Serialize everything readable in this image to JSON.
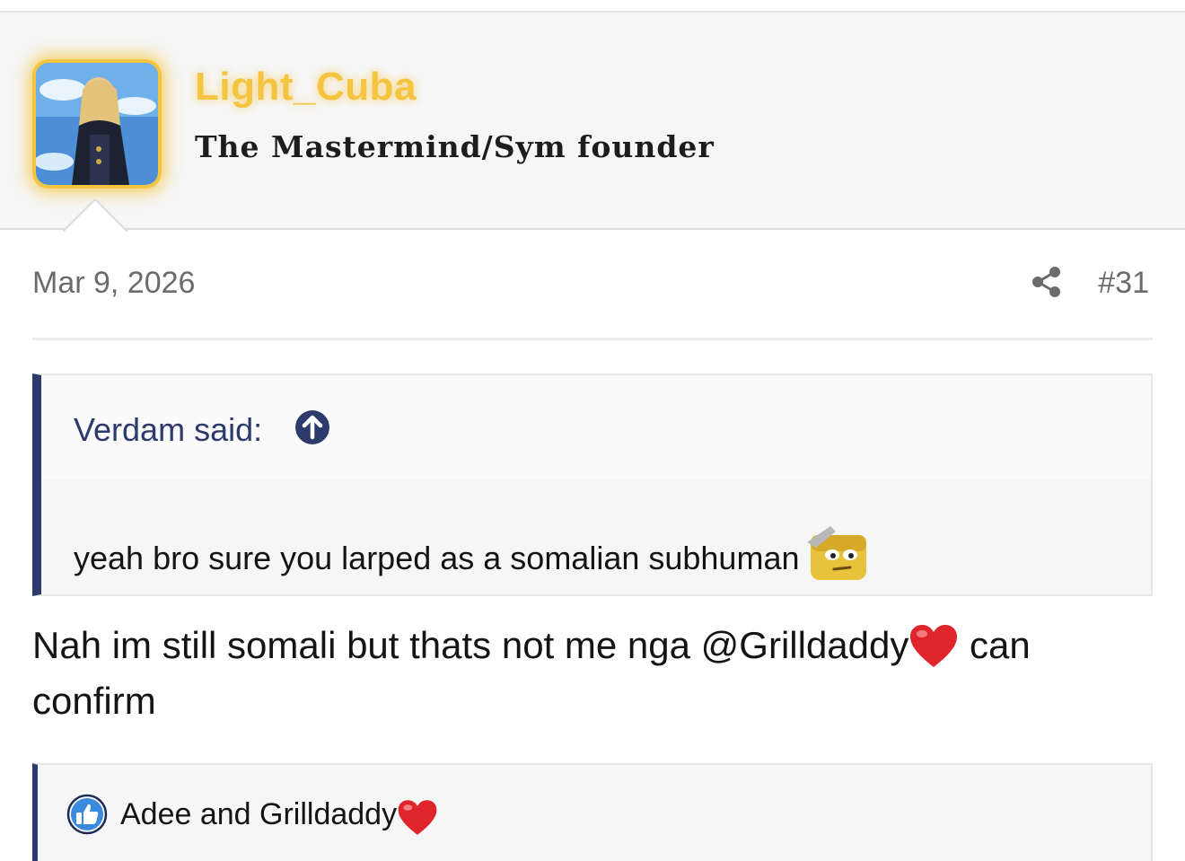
{
  "user": {
    "name": "Light_Cuba",
    "title": "The Mastermind/Sym founder",
    "accent_color": "#f5c542"
  },
  "post": {
    "date": "Mar 9, 2026",
    "number": "#31",
    "share_icon": "share-icon"
  },
  "quote": {
    "author": "Verdam said:",
    "text": "yeah bro sure you larped as a somalian subhuman",
    "emoji": "salute-face-emoji",
    "accent_color": "#2d3a6c"
  },
  "message": {
    "line1_prefix": "Nah im still somali but thats not me nga @Grilldaddy",
    "line1_suffix": " can",
    "line2": "confirm"
  },
  "reactions": {
    "icon": "like-icon",
    "text": "Adee and Grilldaddy"
  }
}
